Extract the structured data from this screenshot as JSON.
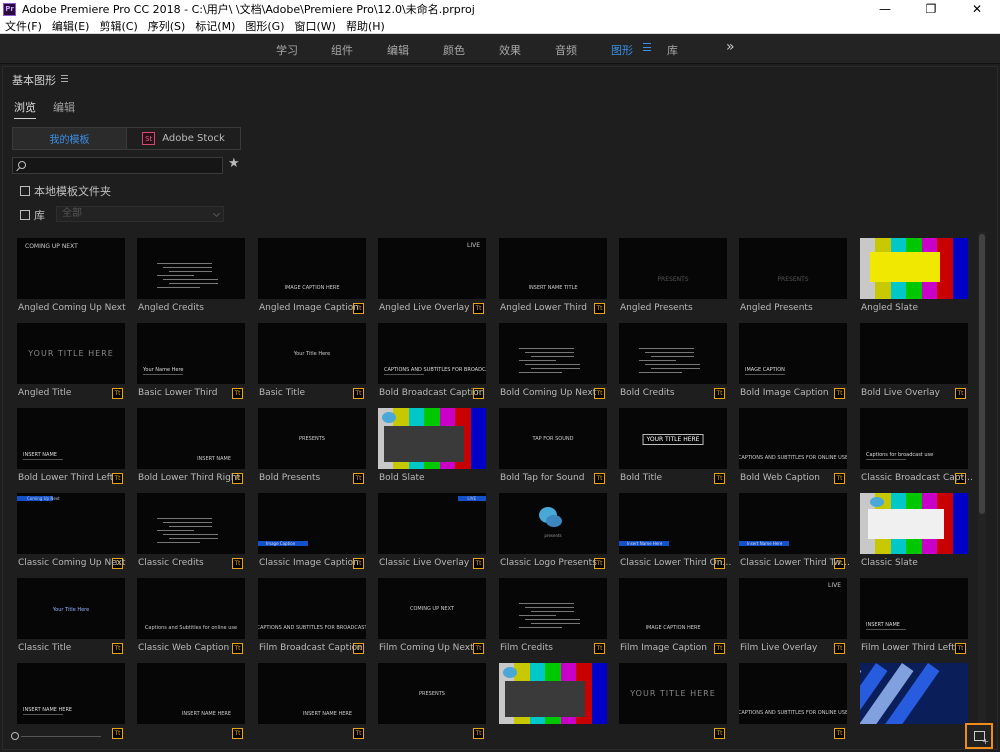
{
  "titlebar": {
    "title": "Adobe Premiere Pro CC 2018 - C:\\用户\\        \\文档\\Adobe\\Premiere Pro\\12.0\\未命名.prproj",
    "logo_text": "Pr",
    "minimize": "—",
    "restore": "❐",
    "close": "✕"
  },
  "menubar": [
    "文件(F)",
    "编辑(E)",
    "剪辑(C)",
    "序列(S)",
    "标记(M)",
    "图形(G)",
    "窗口(W)",
    "帮助(H)"
  ],
  "workspaces": [
    {
      "label": "学习",
      "active": false
    },
    {
      "label": "组件",
      "active": false
    },
    {
      "label": "编辑",
      "active": false
    },
    {
      "label": "颜色",
      "active": false
    },
    {
      "label": "效果",
      "active": false
    },
    {
      "label": "音频",
      "active": false
    },
    {
      "label": "图形",
      "active": true
    },
    {
      "label": "库",
      "active": false
    }
  ],
  "workspace_more": "»",
  "panel": {
    "title": "基本图形",
    "tabs": [
      {
        "label": "浏览",
        "active": true
      },
      {
        "label": "编辑",
        "active": false
      }
    ],
    "source_tabs": [
      {
        "label": "我的模板",
        "active": true
      },
      {
        "label": "Adobe Stock",
        "active": false,
        "logo": "St"
      }
    ],
    "search_placeholder": "",
    "star": "★",
    "local_templates_label": "本地模板文件夹",
    "library_label": "库",
    "library_select": "全部"
  },
  "templates": [
    {
      "label": "Angled Coming Up Next",
      "badge": false,
      "style": "text-tl",
      "text": "COMING UP NEXT"
    },
    {
      "label": "Angled Credits",
      "badge": false,
      "style": "credits",
      "text": ""
    },
    {
      "label": "Angled Image Caption",
      "badge": true,
      "style": "text-bc",
      "text": "IMAGE CAPTION HERE"
    },
    {
      "label": "Angled Live Overlay",
      "badge": true,
      "style": "text-tr",
      "text": "LIVE"
    },
    {
      "label": "Angled Lower Third",
      "badge": true,
      "style": "text-bc",
      "text": "INSERT NAME TITLE"
    },
    {
      "label": "Angled Presents",
      "badge": false,
      "style": "text-c-dim",
      "text": "PRESENTS"
    },
    {
      "label": "Angled Presents",
      "badge": false,
      "style": "text-c-dim",
      "text": "PRESENTS"
    },
    {
      "label": "Angled Slate",
      "badge": false,
      "style": "slate-yellow",
      "text": ""
    },
    {
      "label": "Angled Title",
      "badge": true,
      "style": "text-c-big",
      "text": "YOUR TITLE HERE"
    },
    {
      "label": "Basic Lower Third",
      "badge": true,
      "style": "text-bl",
      "text": "Your Name Here"
    },
    {
      "label": "Basic Title",
      "badge": true,
      "style": "text-c",
      "text": "Your Title Here"
    },
    {
      "label": "Bold Broadcast Caption",
      "badge": true,
      "style": "text-bl",
      "text": "CAPTIONS AND SUBTITLES FOR BROADCAST"
    },
    {
      "label": "Bold Coming Up Next",
      "badge": true,
      "style": "credits",
      "text": ""
    },
    {
      "label": "Bold Credits",
      "badge": true,
      "style": "credits",
      "text": ""
    },
    {
      "label": "Bold Image Caption",
      "badge": true,
      "style": "text-bl",
      "text": "IMAGE CAPTION"
    },
    {
      "label": "Bold Live Overlay",
      "badge": true,
      "style": "blank",
      "text": ""
    },
    {
      "label": "Bold Lower Third Left",
      "badge": true,
      "style": "text-bl",
      "text": "INSERT NAME"
    },
    {
      "label": "Bold Lower Third Right",
      "badge": true,
      "style": "text-br",
      "text": "INSERT NAME"
    },
    {
      "label": "Bold Presents",
      "badge": true,
      "style": "text-c",
      "text": "PRESENTS"
    },
    {
      "label": "Bold Slate",
      "badge": false,
      "style": "slate-gray",
      "text": ""
    },
    {
      "label": "Bold Tap for Sound",
      "badge": true,
      "style": "text-c",
      "text": "TAP FOR SOUND"
    },
    {
      "label": "Bold Title",
      "badge": true,
      "style": "text-c-box",
      "text": "YOUR TITLE HERE"
    },
    {
      "label": "Bold Web Caption",
      "badge": true,
      "style": "text-bc",
      "text": "CAPTIONS AND SUBTITLES FOR ONLINE USE"
    },
    {
      "label": "Classic Broadcast Caption",
      "badge": true,
      "style": "text-bl",
      "text": "Captions for broadcast use"
    },
    {
      "label": "Classic Coming Up Next",
      "badge": true,
      "style": "bluebar-tl",
      "text": "Coming Up Next"
    },
    {
      "label": "Classic Credits",
      "badge": true,
      "style": "credits",
      "text": ""
    },
    {
      "label": "Classic Image Caption",
      "badge": true,
      "style": "bluebar-bl",
      "text": "Image Caption"
    },
    {
      "label": "Classic Live Overlay",
      "badge": true,
      "style": "bluebar-tr",
      "text": "LIVE"
    },
    {
      "label": "Classic Logo Presents",
      "badge": true,
      "style": "logo",
      "text": "presents"
    },
    {
      "label": "Classic Lower Third One L...",
      "badge": true,
      "style": "bluebar-bl",
      "text": "Insert Name Here"
    },
    {
      "label": "Classic Lower Third Two ...",
      "badge": true,
      "style": "bluebar-bl",
      "text": "Insert Name Here"
    },
    {
      "label": "Classic Slate",
      "badge": false,
      "style": "slate-white",
      "text": ""
    },
    {
      "label": "Classic Title",
      "badge": true,
      "style": "text-c-blue",
      "text": "Your Title Here"
    },
    {
      "label": "Classic Web Caption",
      "badge": true,
      "style": "text-bc",
      "text": "Captions and Subtitles for online use"
    },
    {
      "label": "Film Broadcast Caption",
      "badge": true,
      "style": "text-bc",
      "text": "CAPTIONS AND SUBTITLES FOR BROADCAST"
    },
    {
      "label": "Film Coming Up Next",
      "badge": true,
      "style": "text-c",
      "text": "COMING UP NEXT"
    },
    {
      "label": "Film Credits",
      "badge": true,
      "style": "credits",
      "text": ""
    },
    {
      "label": "Film Image Caption",
      "badge": true,
      "style": "text-bc",
      "text": "IMAGE CAPTION HERE"
    },
    {
      "label": "Film Live Overlay",
      "badge": true,
      "style": "text-tr",
      "text": "LIVE"
    },
    {
      "label": "Film Lower Third Left",
      "badge": true,
      "style": "text-bl",
      "text": "INSERT NAME"
    },
    {
      "label": "",
      "badge": true,
      "style": "text-bl",
      "text": "INSERT NAME HERE"
    },
    {
      "label": "",
      "badge": true,
      "style": "text-br",
      "text": "INSERT NAME HERE"
    },
    {
      "label": "",
      "badge": true,
      "style": "text-br",
      "text": "INSERT NAME HERE"
    },
    {
      "label": "",
      "badge": true,
      "style": "text-c",
      "text": "PRESENTS"
    },
    {
      "label": "",
      "badge": false,
      "style": "slate-gray",
      "text": ""
    },
    {
      "label": "",
      "badge": true,
      "style": "text-c-big",
      "text": "YOUR TITLE HERE"
    },
    {
      "label": "",
      "badge": true,
      "style": "text-bc",
      "text": "CAPTIONS AND SUBTITLES FOR ONLINE USE"
    },
    {
      "label": "",
      "badge": false,
      "style": "bluestripes",
      "text": ""
    }
  ],
  "badge_text": "Tt",
  "colors": {
    "accent_blue": "#3b8fe8",
    "badge_orange": "#e8a317",
    "highlight_orange": "#f08c1c",
    "slate_yellow": "#f0e800"
  }
}
